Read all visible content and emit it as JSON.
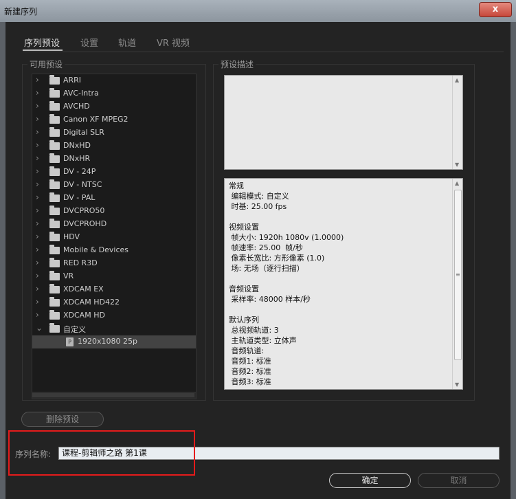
{
  "window": {
    "title": "新建序列",
    "close_glyph": "x"
  },
  "tabs": [
    {
      "label": "序列预设",
      "active": true
    },
    {
      "label": "设置",
      "active": false
    },
    {
      "label": "轨道",
      "active": false
    },
    {
      "label": "VR 视频",
      "active": false
    }
  ],
  "presets": {
    "group_label": "可用预设",
    "items": [
      {
        "label": "ARRI",
        "type": "folder",
        "expanded": false
      },
      {
        "label": "AVC-Intra",
        "type": "folder",
        "expanded": false
      },
      {
        "label": "AVCHD",
        "type": "folder",
        "expanded": false
      },
      {
        "label": "Canon XF MPEG2",
        "type": "folder",
        "expanded": false
      },
      {
        "label": "Digital SLR",
        "type": "folder",
        "expanded": false
      },
      {
        "label": "DNxHD",
        "type": "folder",
        "expanded": false
      },
      {
        "label": "DNxHR",
        "type": "folder",
        "expanded": false
      },
      {
        "label": "DV - 24P",
        "type": "folder",
        "expanded": false
      },
      {
        "label": "DV - NTSC",
        "type": "folder",
        "expanded": false
      },
      {
        "label": "DV - PAL",
        "type": "folder",
        "expanded": false
      },
      {
        "label": "DVCPRO50",
        "type": "folder",
        "expanded": false
      },
      {
        "label": "DVCPROHD",
        "type": "folder",
        "expanded": false
      },
      {
        "label": "HDV",
        "type": "folder",
        "expanded": false
      },
      {
        "label": "Mobile & Devices",
        "type": "folder",
        "expanded": false
      },
      {
        "label": "RED R3D",
        "type": "folder",
        "expanded": false
      },
      {
        "label": "VR",
        "type": "folder",
        "expanded": false
      },
      {
        "label": "XDCAM EX",
        "type": "folder",
        "expanded": false
      },
      {
        "label": "XDCAM HD422",
        "type": "folder",
        "expanded": false
      },
      {
        "label": "XDCAM HD",
        "type": "folder",
        "expanded": false
      },
      {
        "label": "自定义",
        "type": "folder",
        "expanded": true
      },
      {
        "label": "1920x1080 25p",
        "type": "preset",
        "selected": true
      }
    ]
  },
  "description": {
    "group_label": "预设描述",
    "upper_text": "",
    "details": "常规\n 编辑模式: 自定义\n 时基: 25.00 fps\n\n视频设置\n 帧大小: 1920h 1080v (1.0000)\n 帧速率: 25.00  帧/秒\n 像素长宽比: 方形像素 (1.0)\n 场: 无场（逐行扫描）\n\n音频设置\n 采样率: 48000 样本/秒\n\n默认序列\n 总视频轨道: 3\n 主轨道类型: 立体声\n 音频轨道:\n 音频1: 标准\n 音频2: 标准\n 音频3: 标准"
  },
  "buttons": {
    "delete": "删除预设",
    "ok": "确定",
    "cancel": "取消"
  },
  "sequence_name": {
    "label": "序列名称:",
    "value": "课程-剪辑师之路 第1课"
  },
  "colors": {
    "highlight": "#e51b1b",
    "background": "#232323"
  }
}
